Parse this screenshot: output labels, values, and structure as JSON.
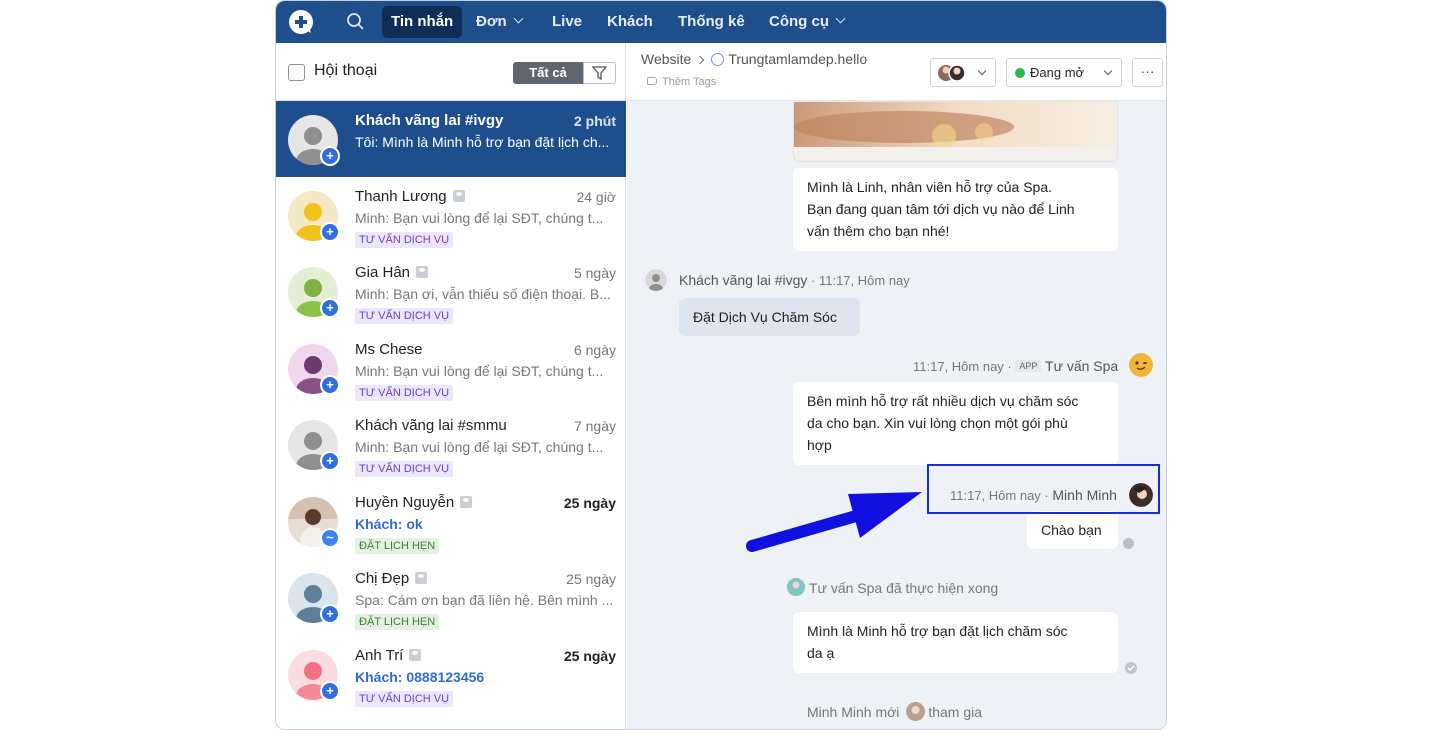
{
  "nav": {
    "items": [
      "Tin nhắn",
      "Đơn",
      "Live",
      "Khách",
      "Thống kê",
      "Công cụ"
    ],
    "active": "Tin nhắn"
  },
  "left": {
    "title": "Hội thoại",
    "filter_all": "Tất cả"
  },
  "conversations": [
    {
      "name": "Khách vãng lai #ivgy",
      "time": "2 phút",
      "message": "Tôi: Mình là Minh hỗ trợ bạn đặt lịch ch...",
      "tag": "",
      "active": true
    },
    {
      "name": "Thanh Lương",
      "time": "24 giờ",
      "message": "Minh: Bạn vui lòng để lại SĐT, chúng t...",
      "tag": "TƯ VẤN DỊCH VỤ"
    },
    {
      "name": "Gia Hân",
      "time": "5 ngày",
      "message": "Minh: Bạn ơi, vẫn thiếu số điện thoại. B...",
      "tag": "TƯ VẤN DỊCH VỤ"
    },
    {
      "name": "Ms Chese",
      "time": "6 ngày",
      "message": "Minh: Bạn vui lòng để lại SĐT, chúng t...",
      "tag": "TƯ VẤN DỊCH VỤ"
    },
    {
      "name": "Khách vãng lai #smmu",
      "time": "7 ngày",
      "message": "Minh: Bạn vui lòng để lại SĐT, chúng t...",
      "tag": "TƯ VẤN DỊCH VỤ"
    },
    {
      "name": "Huyền Nguyễn",
      "time": "25 ngày",
      "message": "Khách: ok",
      "tag": "ĐẶT LỊCH HẸN"
    },
    {
      "name": "Chị Đẹp",
      "time": "25 ngày",
      "message": "Spa: Cám ơn bạn đã liên hệ. Bên mình ...",
      "tag": "ĐẶT LỊCH HẸN"
    },
    {
      "name": "Anh Trí",
      "time": "25 ngày",
      "message": "Khách: 0888123456",
      "tag": "TƯ VẤN DỊCH VỤ"
    }
  ],
  "chat": {
    "breadcrumb_source": "Website",
    "breadcrumb_page": "Trungtamlamdep.hello",
    "add_tags": "Thêm Tags",
    "status": "Đang mở",
    "more": "···",
    "messages": {
      "intro": [
        "Mình là Linh, nhân viên hỗ trợ của Spa.",
        "Bạn đang quan tâm tới dịch vụ nào để Linh",
        "vấn thêm cho bạn nhé!"
      ],
      "cust_name": "Khách vãng lai #ivgy",
      "cust_time": " · 11:17, Hôm nay",
      "cust_text": "Đặt Dịch Vụ Chăm Sóc",
      "bot_time": "11:17, Hôm nay ·",
      "bot_chip": "APP",
      "bot_name": "Tư vấn Spa",
      "bot_text": [
        "Bên mình hỗ trợ rất nhiều dịch vụ chăm sóc",
        "da cho bạn. Xin vui lòng chọn một gói phù",
        "hợp"
      ],
      "agent_time": "11:17, Hôm nay ·",
      "agent_name": "Minh Minh",
      "agent_text": "Chào bạn",
      "system_done": "Tư vấn Spa đã thực hiện xong",
      "final_text": [
        "Mình là Minh hỗ trợ bạn đặt lịch chăm sóc",
        "da ạ"
      ],
      "joined_name": "Minh Minh mới",
      "joined_suffix": "tham gia"
    }
  },
  "colors": {
    "nav_bg": "#1e4f8c",
    "active_conv": "#1e4f8c",
    "highlight_box": "#1c2bd0",
    "arrow": "#1010e0"
  }
}
